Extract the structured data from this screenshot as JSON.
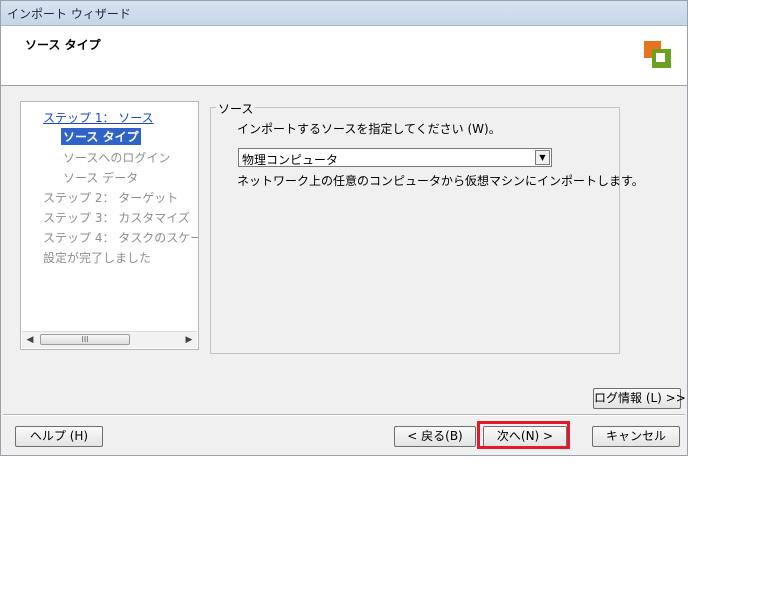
{
  "window": {
    "title": "インポート ウィザード"
  },
  "header": {
    "title": "ソース タイプ",
    "logo_icon": "vmware-converter-logo"
  },
  "steps": [
    {
      "label": "ステップ 1： ソース",
      "state": "link"
    },
    {
      "label": "ソース タイプ",
      "state": "current"
    },
    {
      "label": "ソースへのログイン",
      "state": "disabled"
    },
    {
      "label": "ソース データ",
      "state": "disabled"
    },
    {
      "label": "ステップ 2： ターゲット",
      "state": "disabled"
    },
    {
      "label": "ステップ 3： カスタマイズ",
      "state": "disabled"
    },
    {
      "label": "ステップ 4： タスクのスケー",
      "state": "disabled"
    },
    {
      "label": "設定が完了しました",
      "state": "disabled"
    }
  ],
  "scrollbar": {
    "thumb_grip": "III"
  },
  "source": {
    "group_label": "ソース",
    "prompt": "インポートするソースを指定してください (W)。",
    "selected": "物理コンピュータ",
    "description": "ネットワーク上の任意のコンピュータから仮想マシンにインポートします。"
  },
  "buttons": {
    "log": "ログ情報 (L) >>",
    "help": "ヘルプ (H)",
    "back": "< 戻る(B)",
    "next": "次へ(N) >",
    "cancel": "キャンセル"
  },
  "colors": {
    "highlight": "#e1192a",
    "selection": "#2f63c9",
    "link": "#1d47c9"
  }
}
